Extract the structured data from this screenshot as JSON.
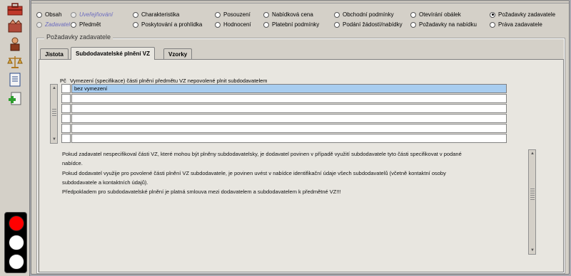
{
  "toolbar": {
    "icons": [
      "toolbox-icon",
      "hand-icon",
      "person-icon",
      "scales-icon",
      "document-icon",
      "add-document-icon"
    ],
    "traffic_light": {
      "active": "red",
      "colors": {
        "red": "#ff0000",
        "off": "#ffffff"
      }
    }
  },
  "nav": {
    "row1": [
      {
        "label": "Obsah",
        "state": "normal"
      },
      {
        "label": "Uveřejňování",
        "state": "disabled"
      },
      {
        "label": "Charakteristika",
        "state": "normal"
      },
      {
        "label": "Posouzení",
        "state": "normal"
      },
      {
        "label": "Nabídková cena",
        "state": "normal"
      },
      {
        "label": "Obchodní podmínky",
        "state": "normal"
      },
      {
        "label": "Otevírání obálek",
        "state": "normal"
      },
      {
        "label": "Požadavky zadavatele",
        "state": "checked"
      }
    ],
    "row2": [
      {
        "label": "Zadavatel",
        "state": "disabled"
      },
      {
        "label": "Předmět",
        "state": "normal"
      },
      {
        "label": "Poskytování a prohlídka",
        "state": "normal"
      },
      {
        "label": "Hodnocení",
        "state": "normal"
      },
      {
        "label": "Platební podmínky",
        "state": "normal"
      },
      {
        "label": "Podání žádostí/nabídky",
        "state": "normal"
      },
      {
        "label": "Požadavky na nabídku",
        "state": "normal"
      },
      {
        "label": "Práva zadavatele",
        "state": "normal"
      }
    ]
  },
  "group": {
    "title": "Požadavky zadavatele",
    "tabs": [
      {
        "label": "Jistota",
        "active": false
      },
      {
        "label": "Subdodavatelské plnění VZ",
        "active": true
      },
      {
        "label": "Vzorky",
        "active": false
      }
    ]
  },
  "table": {
    "col_num": "Pč",
    "col_text": "Vymezení (specifikace) části plnění předmětu VZ nepovolené plnit subdodavatelem",
    "rows": [
      {
        "num": "",
        "text": "bez vymezení",
        "selected": true
      },
      {
        "num": "",
        "text": "",
        "selected": false
      },
      {
        "num": "",
        "text": "",
        "selected": false
      },
      {
        "num": "",
        "text": "",
        "selected": false
      },
      {
        "num": "",
        "text": "",
        "selected": false
      },
      {
        "num": "",
        "text": "",
        "selected": false
      }
    ]
  },
  "info": {
    "line1": "Pokud zadavatel nespecifikoval části VZ, které mohou být plněny subdodavatelsky, je dodavatel povinen v případě využití subdodavatele tyto části specifikovat v podané",
    "line2": "nabídce.",
    "line3": "Pokud dodavatel využije pro povolené části plnění VZ subdodavatele, je povinen uvést v nabídce identifikační údaje všech subdodavatelů (včetně kontaktní osoby",
    "line4": "subdodavatele a kontaktních údajů).",
    "line5": "Předpokladem pro subdodavatelské plnění je platná smlouva mezi dodavatelem a subdodavatelem k předmětné VZ!!!"
  }
}
